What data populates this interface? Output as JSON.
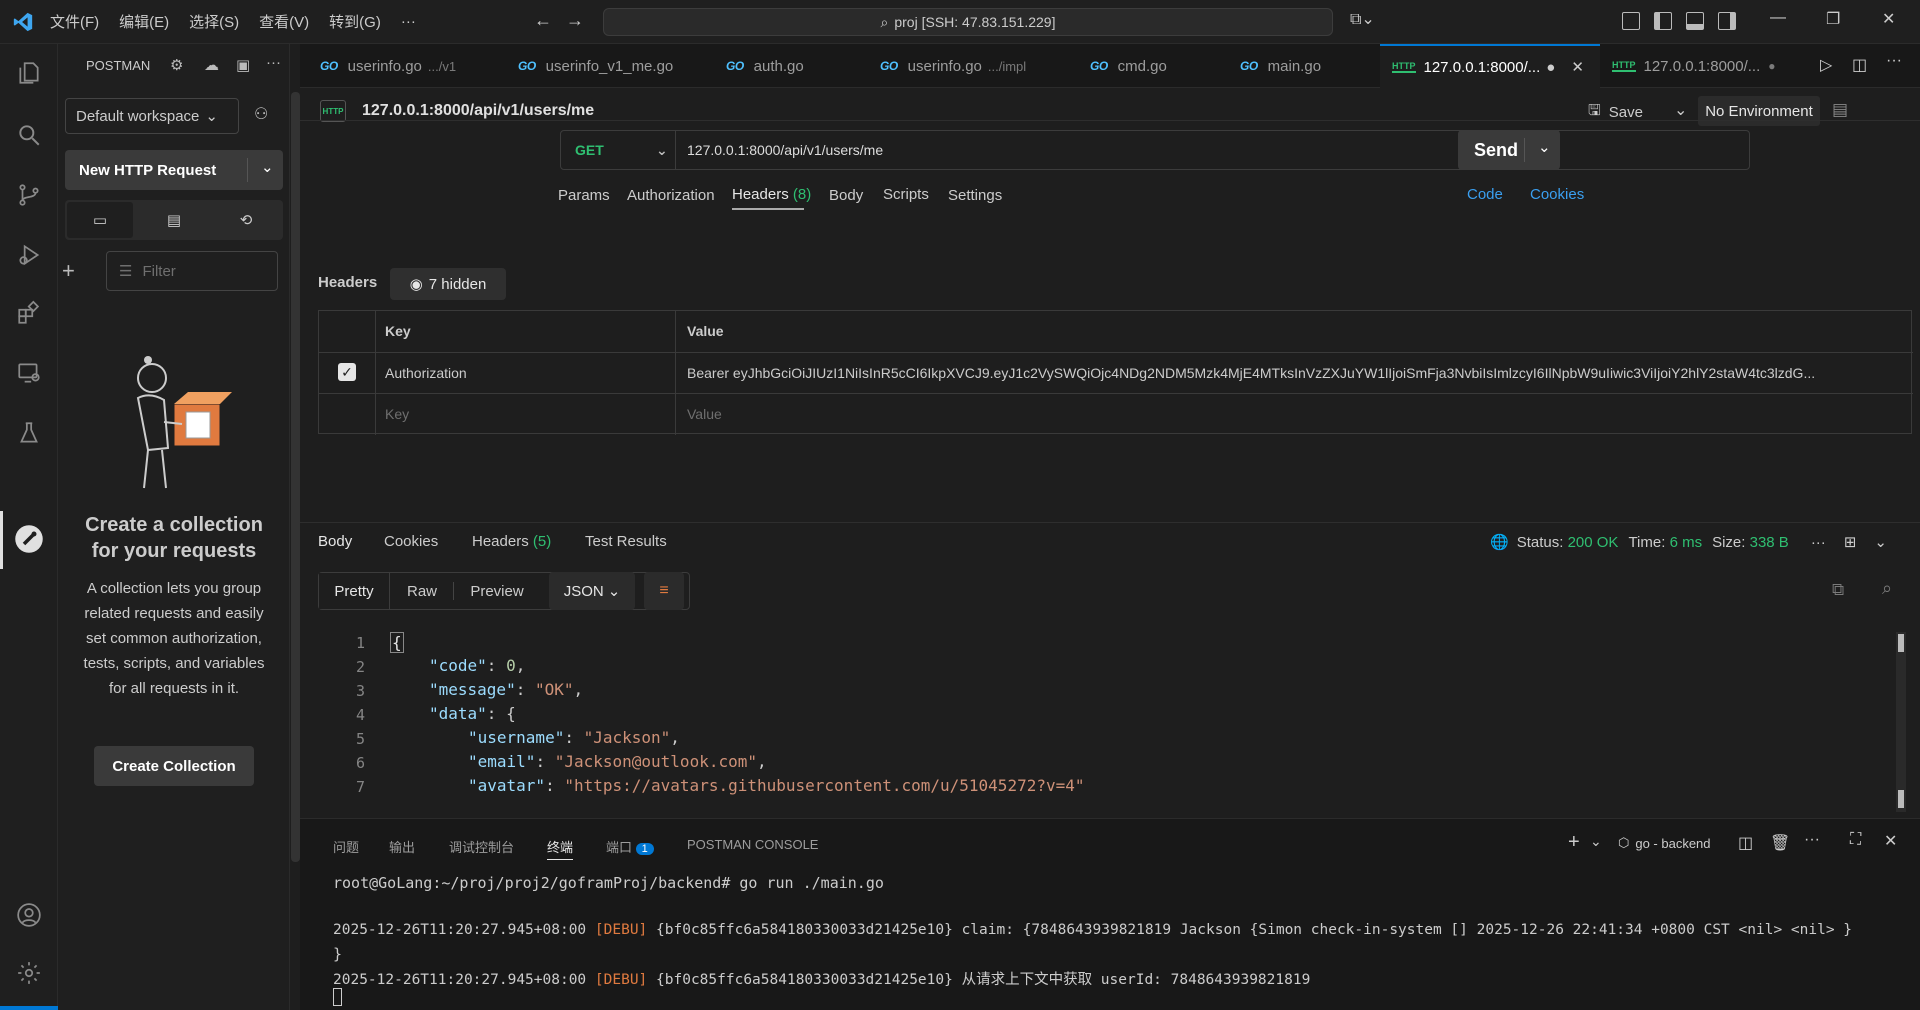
{
  "titlebar": {
    "menu": [
      "文件(F)",
      "编辑(E)",
      "选择(S)",
      "查看(V)",
      "转到(G)",
      "···"
    ],
    "search": "proj [SSH: 47.83.151.229]"
  },
  "postman": {
    "label": "POSTMAN",
    "workspace": "Default workspace",
    "new_request": "New HTTP Request",
    "filter_placeholder": "Filter",
    "empty_title": "Create a collection for your requests",
    "empty_body": "A collection lets you group related requests and easily set common authorization, tests, scripts, and variables for all requests in it.",
    "create_collection": "Create Collection"
  },
  "tabs": [
    {
      "label": "userinfo.go",
      "suffix": ".../v1",
      "type": "go"
    },
    {
      "label": "userinfo_v1_me.go",
      "suffix": "",
      "type": "go"
    },
    {
      "label": "auth.go",
      "suffix": "",
      "type": "go"
    },
    {
      "label": "userinfo.go",
      "suffix": ".../impl",
      "type": "go"
    },
    {
      "label": "cmd.go",
      "suffix": "",
      "type": "go"
    },
    {
      "label": "main.go",
      "suffix": "",
      "type": "go"
    },
    {
      "label": "127.0.0.1:8000/...",
      "suffix": "",
      "type": "http",
      "active": true
    },
    {
      "label": "127.0.0.1:8000/...",
      "suffix": "",
      "type": "http"
    }
  ],
  "request": {
    "title": "127.0.0.1:8000/api/v1/users/me",
    "save": "Save",
    "environment": "No Environment",
    "method": "GET",
    "url": "127.0.0.1:8000/api/v1/users/me",
    "send": "Send",
    "tabs": [
      "Params",
      "Authorization",
      "Headers",
      "Body",
      "Scripts",
      "Settings"
    ],
    "headers_count": "(8)",
    "code_link": "Code",
    "cookies_link": "Cookies",
    "headers_label": "Headers",
    "hidden": "7 hidden",
    "table_key": "Key",
    "table_value": "Value",
    "row_key": "Authorization",
    "row_value": "Bearer eyJhbGciOiJIUzI1NiIsInR5cCI6IkpXVCJ9.eyJ1c2VySWQiOjc4NDg2NDM5Mzk4MjE4MTksInVzZXJuYW1lIjoiSmFja3NvbiIsImlzcyI6IlNpbW9uIiwic3ViIjoiY2hlY2staW4tc3lzdG...",
    "placeholder_key": "Key",
    "placeholder_value": "Value"
  },
  "response": {
    "tabs": [
      "Body",
      "Cookies",
      "Headers",
      "Test Results"
    ],
    "headers_count": "(5)",
    "status_label": "Status:",
    "status": "200 OK",
    "time_label": "Time:",
    "time": "6 ms",
    "size_label": "Size:",
    "size": "338 B",
    "views": [
      "Pretty",
      "Raw",
      "Preview"
    ],
    "format": "JSON",
    "line_numbers": [
      "1",
      "2",
      "3",
      "4",
      "5",
      "6",
      "7"
    ],
    "code_key_code": "\"code\"",
    "code_val_code": "0",
    "code_key_message": "\"message\"",
    "code_val_message": "\"OK\"",
    "code_key_data": "\"data\"",
    "code_key_username": "\"username\"",
    "code_val_username": "\"Jackson\"",
    "code_key_email": "\"email\"",
    "code_val_email": "\"Jackson@outlook.com\"",
    "code_key_avatar": "\"avatar\"",
    "code_val_avatar": "\"https://avatars.githubusercontent.com/u/51045272?v=4\""
  },
  "panel": {
    "tabs": [
      "问题",
      "输出",
      "调试控制台",
      "终端",
      "端口",
      "POSTMAN CONSOLE"
    ],
    "ports_badge": "1",
    "terminal_name": "go - backend",
    "prompt": "root@GoLang:~/proj/proj2/goframProj/backend# go run ./main.go",
    "line1_time": "2025-12-26T11:20:27.945+08:00",
    "line1_level": "[DEBU]",
    "line1_msg": "{bf0c85ffc6a584180330033d21425e10} claim: {7848643939821819 Jackson {Simon check-in-system [] 2025-12-26 22:41:34 +0800 CST <nil> <nil> }",
    "line1_cont": "}",
    "line2_time": "2025-12-26T11:20:27.945+08:00",
    "line2_level": "[DEBU]",
    "line2_msg": "{bf0c85ffc6a584180330033d21425e10} 从请求上下文中获取 userId: 7848643939821819"
  },
  "colors": {
    "accent": "#0078d4",
    "ok_green": "#2fbf71",
    "postman_orange": "#e07a3f"
  }
}
